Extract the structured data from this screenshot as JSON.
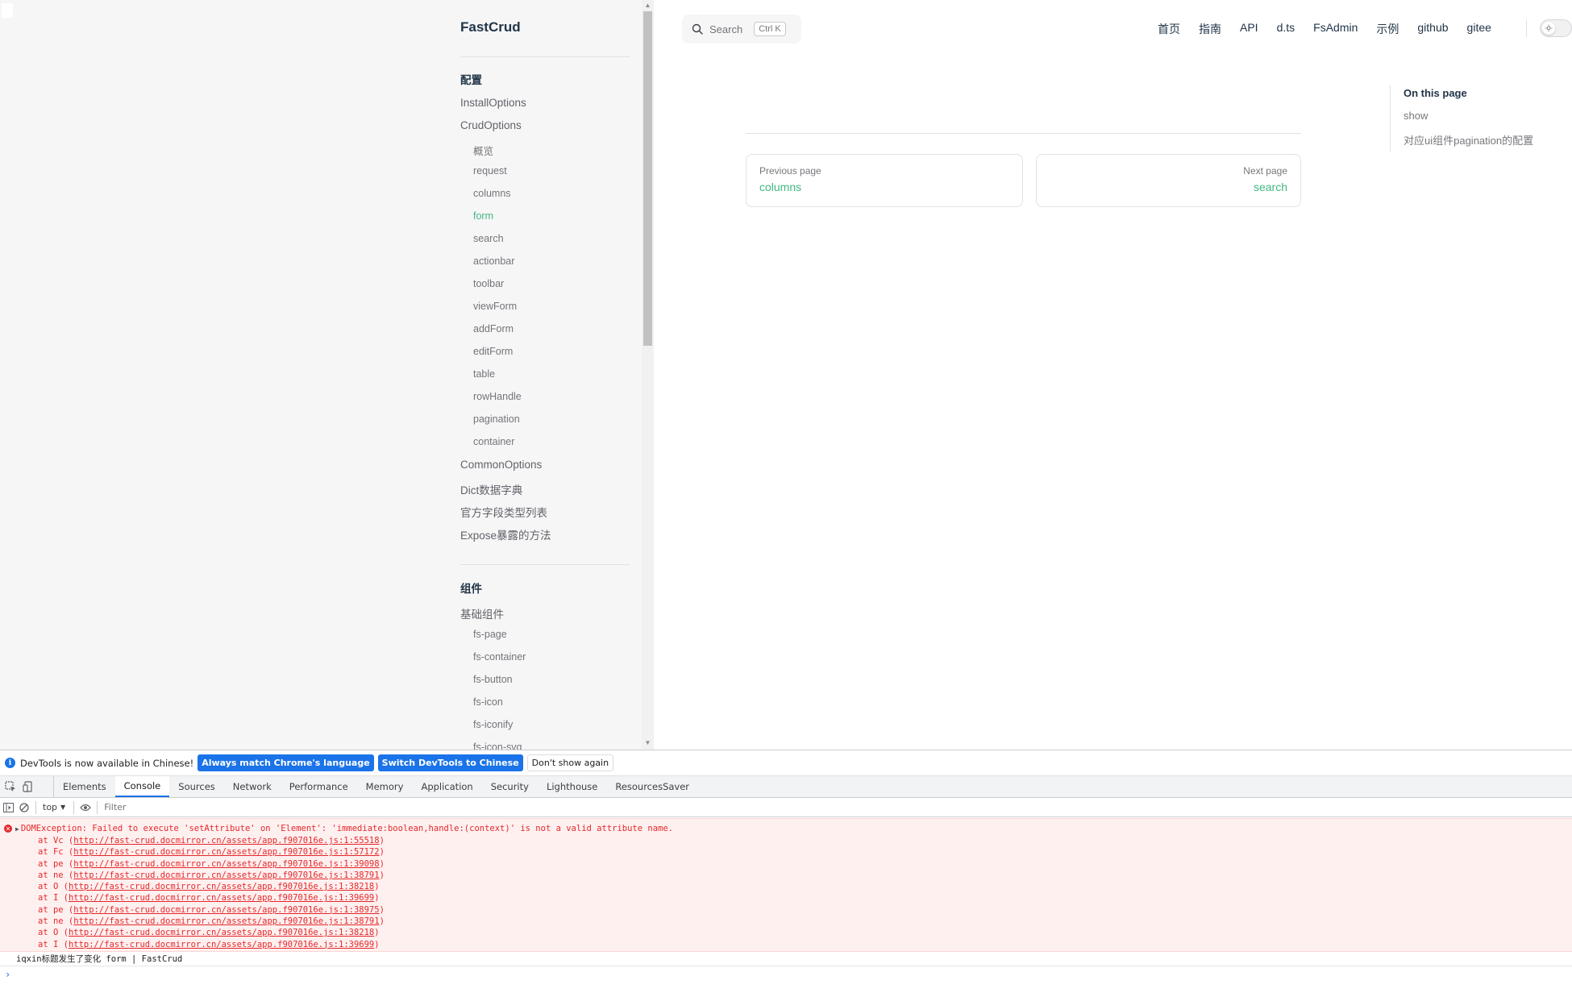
{
  "colors": {
    "accent": "#42b883",
    "devtools_blue": "#1a73e8",
    "error": "#e4282a"
  },
  "sidebar": {
    "brand": "FastCrud",
    "group_config": "配置",
    "items": [
      "InstallOptions",
      "CrudOptions"
    ],
    "crud_sub": [
      "概览",
      "request",
      "columns",
      "form",
      "search",
      "actionbar",
      "toolbar",
      "viewForm",
      "addForm",
      "editForm",
      "table",
      "rowHandle",
      "pagination",
      "container"
    ],
    "more_items": [
      "CommonOptions",
      "Dict数据字典",
      "官方字段类型列表",
      "Expose暴露的方法"
    ],
    "group_components": "组件",
    "basic_components": "基础组件",
    "component_sub": [
      "fs-page",
      "fs-container",
      "fs-button",
      "fs-icon",
      "fs-iconify",
      "fs-icon-svg"
    ]
  },
  "search": {
    "label": "Search",
    "shortcut": "Ctrl K"
  },
  "topnav": [
    "首页",
    "指南",
    "API",
    "d.ts",
    "FsAdmin",
    "示例",
    "github",
    "gitee"
  ],
  "pager": {
    "prev_desc": "Previous page",
    "prev_title": "columns",
    "next_desc": "Next page",
    "next_title": "search"
  },
  "aside": {
    "title": "On this page",
    "links": [
      "show",
      "对应ui组件pagination的配置"
    ]
  },
  "devtools": {
    "info_text": "DevTools is now available in Chinese!",
    "btn_match": "Always match Chrome's language",
    "btn_switch": "Switch DevTools to Chinese",
    "btn_dismiss": "Don't show again",
    "tabs": [
      "Elements",
      "Console",
      "Sources",
      "Network",
      "Performance",
      "Memory",
      "Application",
      "Security",
      "Lighthouse",
      "ResourcesSaver"
    ],
    "context": "top",
    "filter_placeholder": "Filter",
    "error_message": "DOMException: Failed to execute 'setAttribute' on 'Element': 'immediate:boolean,handle:(context)' is not a valid attribute name.",
    "frames": [
      {
        "fn": "at Vc",
        "url": "http://fast-crud.docmirror.cn/assets/app.f907016e.js:1:55518"
      },
      {
        "fn": "at Fc",
        "url": "http://fast-crud.docmirror.cn/assets/app.f907016e.js:1:57172"
      },
      {
        "fn": "at pe",
        "url": "http://fast-crud.docmirror.cn/assets/app.f907016e.js:1:39098"
      },
      {
        "fn": "at ne",
        "url": "http://fast-crud.docmirror.cn/assets/app.f907016e.js:1:38791"
      },
      {
        "fn": "at O",
        "url": "http://fast-crud.docmirror.cn/assets/app.f907016e.js:1:38218"
      },
      {
        "fn": "at I",
        "url": "http://fast-crud.docmirror.cn/assets/app.f907016e.js:1:39699"
      },
      {
        "fn": "at pe",
        "url": "http://fast-crud.docmirror.cn/assets/app.f907016e.js:1:38975"
      },
      {
        "fn": "at ne",
        "url": "http://fast-crud.docmirror.cn/assets/app.f907016e.js:1:38791"
      },
      {
        "fn": "at O",
        "url": "http://fast-crud.docmirror.cn/assets/app.f907016e.js:1:38218"
      },
      {
        "fn": "at I",
        "url": "http://fast-crud.docmirror.cn/assets/app.f907016e.js:1:39699"
      }
    ],
    "log_line": "iqxin标题发生了变化 form | FastCrud",
    "prompt": "›"
  }
}
